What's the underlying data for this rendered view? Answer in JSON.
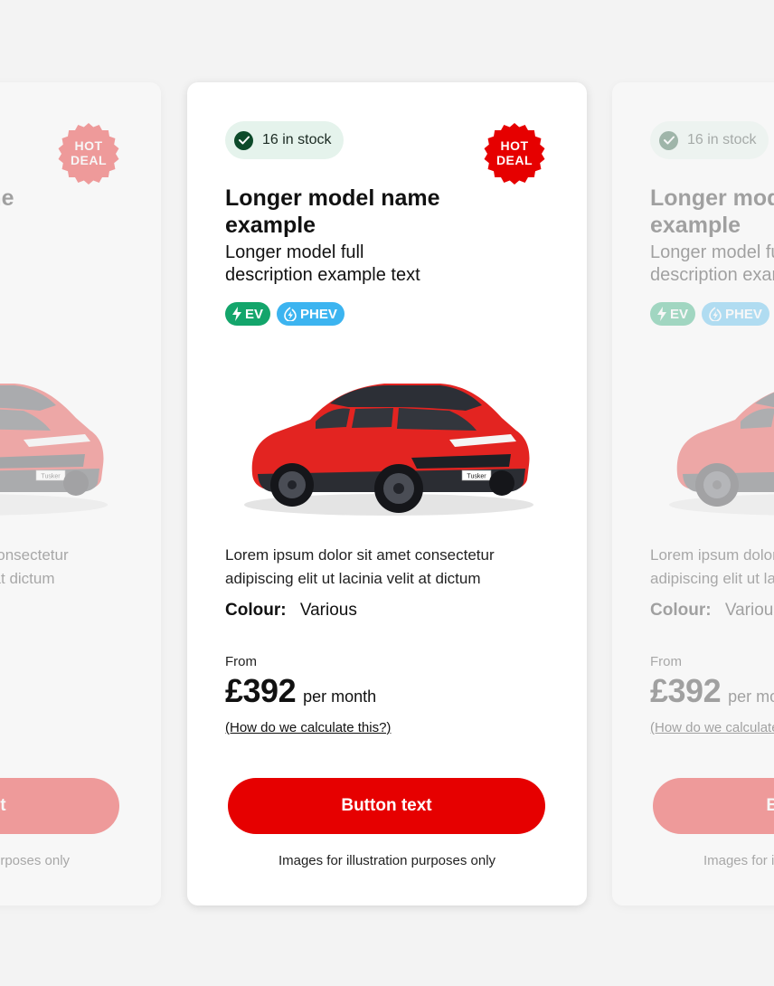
{
  "card": {
    "stock_label": "16 in stock",
    "hot_deal_line1": "HOT",
    "hot_deal_line2": "DEAL",
    "title_line1": "Longer model name",
    "title_line2": "example",
    "description_line1": "Longer model full",
    "description_line2": "description example text",
    "tags": [
      {
        "label": "EV",
        "color": "#13a56b",
        "icon": "lightning-icon"
      },
      {
        "label": "PHEV",
        "color": "#3cb4f0",
        "icon": "lightning-flame-icon"
      }
    ],
    "body_line1": "Lorem ipsum dolor sit amet consectetur",
    "body_line2": "adipiscing elit ut lacinia velit at dictum",
    "colour_label": "Colour:",
    "colour_value": "Various",
    "from_label": "From",
    "price": "£392",
    "price_suffix": "per month",
    "calc_link": "(How do we calculate this?)",
    "button_label": "Button text",
    "disclaimer": "Images for illustration purposes only",
    "plate_text": "Tusker"
  },
  "colors": {
    "accent_red": "#e60000",
    "stock_bg": "#e5f3ec",
    "check_green": "#0d4a2a"
  }
}
